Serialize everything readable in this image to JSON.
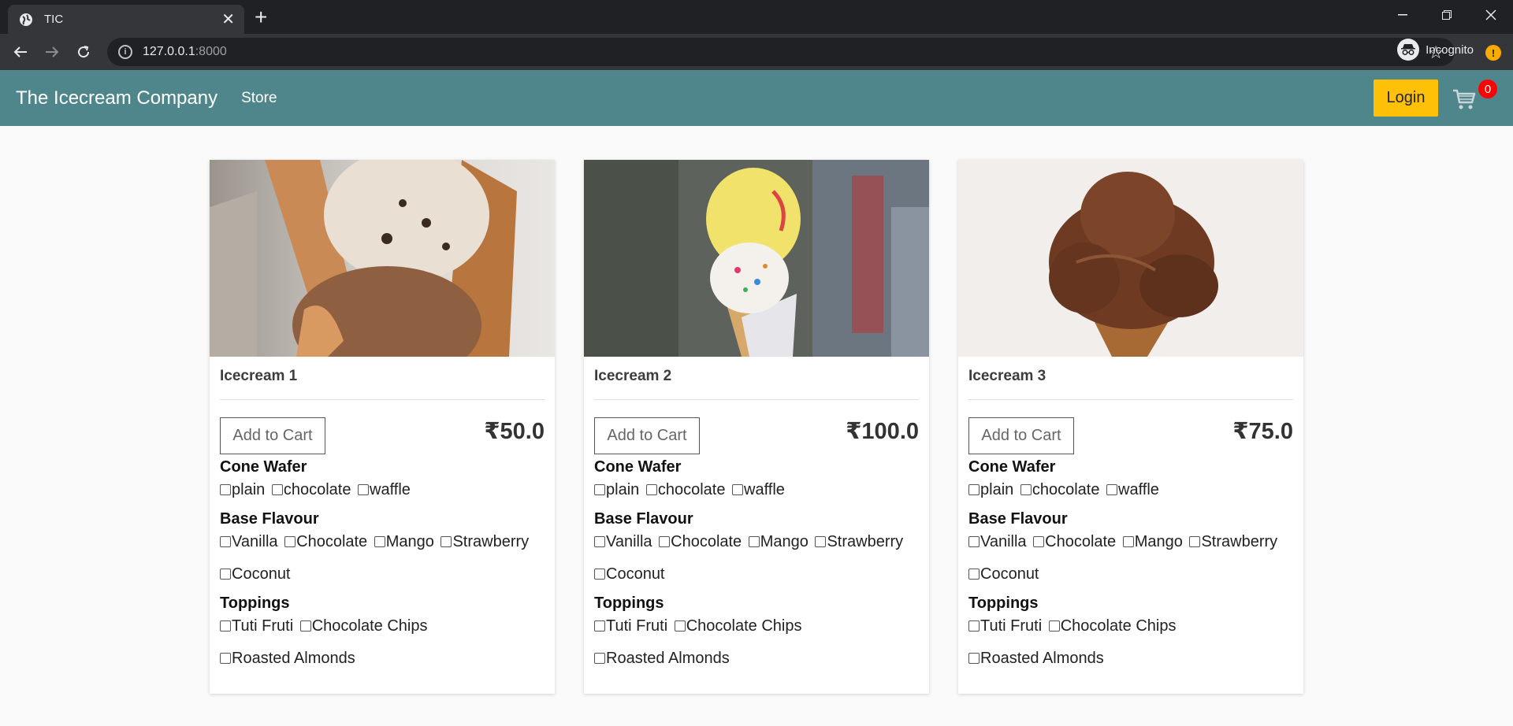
{
  "browser": {
    "tab_title": "TIC",
    "url_host": "127.0.0.1",
    "url_port": ":8000",
    "profile_label": "Incognito"
  },
  "site": {
    "brand": "The Icecream Company",
    "nav_store": "Store",
    "login_label": "Login",
    "cart_count": "0"
  },
  "products": [
    {
      "name": "Icecream 1",
      "price": "₹50.0",
      "add_label": "Add to Cart",
      "cone_heading": "Cone Wafer",
      "cones": [
        "plain",
        "chocolate",
        "waffle"
      ],
      "base_heading": "Base Flavour",
      "bases": [
        "Vanilla",
        "Chocolate",
        "Mango",
        "Strawberry",
        "Coconut"
      ],
      "toppings_heading": "Toppings",
      "toppings": [
        "Tuti Fruti",
        "Chocolate Chips",
        "Roasted Almonds"
      ]
    },
    {
      "name": "Icecream 2",
      "price": "₹100.0",
      "add_label": "Add to Cart",
      "cone_heading": "Cone Wafer",
      "cones": [
        "plain",
        "chocolate",
        "waffle"
      ],
      "base_heading": "Base Flavour",
      "bases": [
        "Vanilla",
        "Chocolate",
        "Mango",
        "Strawberry",
        "Coconut"
      ],
      "toppings_heading": "Toppings",
      "toppings": [
        "Tuti Fruti",
        "Chocolate Chips",
        "Roasted Almonds"
      ]
    },
    {
      "name": "Icecream 3",
      "price": "₹75.0",
      "add_label": "Add to Cart",
      "cone_heading": "Cone Wafer",
      "cones": [
        "plain",
        "chocolate",
        "waffle"
      ],
      "base_heading": "Base Flavour",
      "bases": [
        "Vanilla",
        "Chocolate",
        "Mango",
        "Strawberry",
        "Coconut"
      ],
      "toppings_heading": "Toppings",
      "toppings": [
        "Tuti Fruti",
        "Chocolate Chips",
        "Roasted Almonds"
      ]
    }
  ],
  "colors": {
    "navbar": "#4f868c",
    "login_button": "#ffc107",
    "cart_badge": "#ff0000"
  }
}
